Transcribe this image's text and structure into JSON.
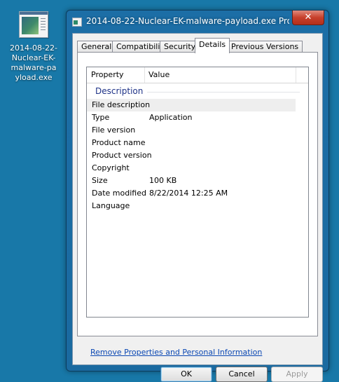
{
  "desktop": {
    "icon_label": "2014-08-22-Nuclear-EK-malware-payload.exe"
  },
  "window": {
    "title": "2014-08-22-Nuclear-EK-malware-payload.exe Proper...",
    "close_symbol": "✕"
  },
  "tabs": [
    "General",
    "Compatibility",
    "Security",
    "Details",
    "Previous Versions"
  ],
  "active_tab": "Details",
  "details": {
    "columns": [
      "Property",
      "Value"
    ],
    "group": "Description",
    "rows": [
      {
        "property": "File description",
        "value": ""
      },
      {
        "property": "Type",
        "value": "Application"
      },
      {
        "property": "File version",
        "value": ""
      },
      {
        "property": "Product name",
        "value": ""
      },
      {
        "property": "Product version",
        "value": ""
      },
      {
        "property": "Copyright",
        "value": ""
      },
      {
        "property": "Size",
        "value": "100 KB"
      },
      {
        "property": "Date modified",
        "value": "8/22/2014 12:25 AM"
      },
      {
        "property": "Language",
        "value": ""
      }
    ],
    "link": "Remove Properties and Personal Information"
  },
  "buttons": {
    "ok": "OK",
    "cancel": "Cancel",
    "apply": "Apply"
  },
  "colors": {
    "desktop": "#1878a8",
    "link": "#0a47b3",
    "group_header": "#1e3287"
  }
}
